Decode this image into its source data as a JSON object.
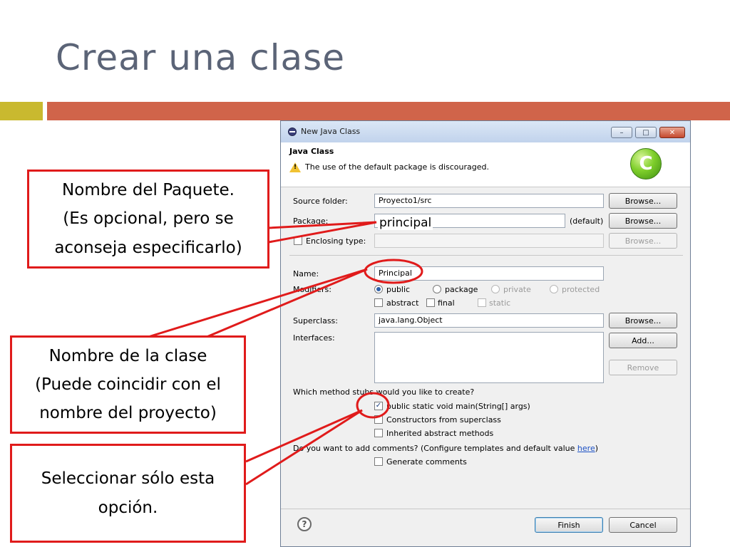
{
  "slide": {
    "title": "Crear una clase",
    "colors": {
      "title": "#5b6477",
      "accent_yellow": "#c9b92f",
      "accent_orange": "#d0644a",
      "callout_red": "#e01b1b"
    }
  },
  "dialog": {
    "window_title": "New Java Class",
    "header": {
      "title": "Java Class",
      "message": "The use of the default package is discouraged.",
      "logo_letter": "C"
    },
    "source_folder": {
      "label": "Source folder:",
      "value": "Proyecto1/src",
      "browse": "Browse..."
    },
    "package": {
      "label": "Package:",
      "value": "",
      "default_hint": "(default)",
      "browse": "Browse..."
    },
    "enclosing": {
      "label": "Enclosing type:",
      "value": "",
      "browse": "Browse..."
    },
    "name": {
      "label": "Name:",
      "value": "Principal"
    },
    "modifiers": {
      "label": "Modifiers:",
      "access": [
        "public",
        "package",
        "private",
        "protected"
      ],
      "selected": "public",
      "flags": [
        "abstract",
        "final",
        "static"
      ]
    },
    "superclass": {
      "label": "Superclass:",
      "value": "java.lang.Object",
      "browse": "Browse..."
    },
    "interfaces": {
      "label": "Interfaces:",
      "add": "Add...",
      "remove": "Remove"
    },
    "stubs": {
      "question": "Which method stubs would you like to create?",
      "main": {
        "label": "public static void main(String[] args)",
        "checked": true
      },
      "constructors": {
        "label": "Constructors from superclass",
        "checked": false
      },
      "inherited": {
        "label": "Inherited abstract methods",
        "checked": false
      }
    },
    "comments": {
      "question": "Do you want to add comments? (Configure templates and default value ",
      "link": "here",
      "question_end": ")",
      "generate": {
        "label": "Generate comments",
        "checked": false
      }
    },
    "footer": {
      "help": "?",
      "finish": "Finish",
      "cancel": "Cancel"
    }
  },
  "annotations": {
    "package_text": "principal",
    "callout_package": "Nombre del Paquete.\n(Es opcional, pero se\naconseja especificarlo)",
    "callout_class": "Nombre de la clase\n(Puede coincidir con el\nnombre del proyecto)",
    "callout_option": "Seleccionar sólo esta\nopción."
  }
}
